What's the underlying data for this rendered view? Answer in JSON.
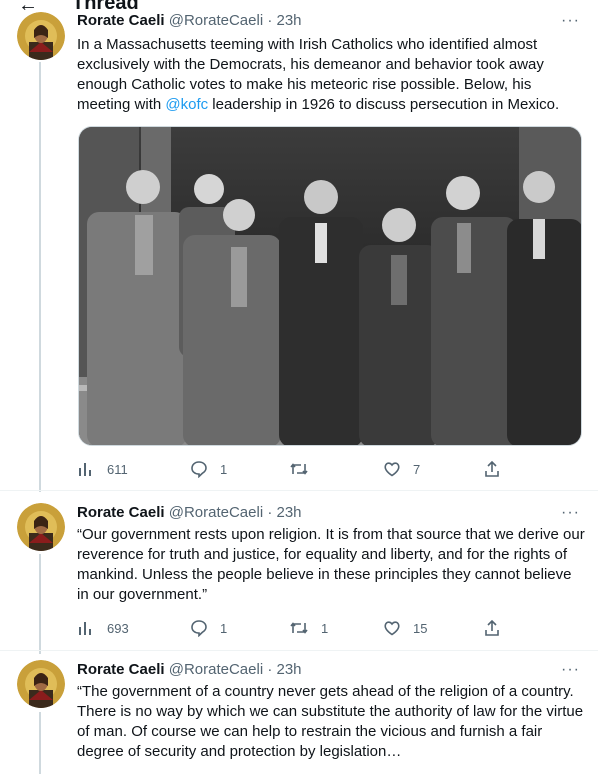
{
  "header": {
    "title": "Thread"
  },
  "tweets": [
    {
      "name": "Rorate Caeli",
      "handle": "@RorateCaeli",
      "sep": "·",
      "time": "23h",
      "text_before": "In a Massachusetts teeming with Irish Catholics who identified almost exclusively with the Democrats, his demeanor and behavior took away enough Catholic votes to make his meteoric rise possible. Below, his meeting with ",
      "mention": "@kofc",
      "text_after": " leadership  in 1926 to discuss persecution in Mexico.",
      "views": "611",
      "replies": "1",
      "retweets": "",
      "likes": "7"
    },
    {
      "name": "Rorate Caeli",
      "handle": "@RorateCaeli",
      "sep": "·",
      "time": "23h",
      "text": "“Our government rests upon religion. It is from that source that we derive our reverence for truth and justice, for equality and liberty, and for the rights of mankind. Unless the people believe in these principles they cannot believe in our government.”",
      "views": "693",
      "replies": "1",
      "retweets": "1",
      "likes": "15"
    },
    {
      "name": "Rorate Caeli",
      "handle": "@RorateCaeli",
      "sep": "·",
      "time": "23h",
      "text": "“The government of a country never gets ahead of the religion of a country. There is no way by which we can substitute the authority of law for the virtue of man. Of course we can help to restrain the vicious and furnish a fair degree of security and protection by legislation…"
    }
  ],
  "colors": {
    "link": "#1d9bf0",
    "secondary": "#536471",
    "line": "#cfd9de"
  }
}
